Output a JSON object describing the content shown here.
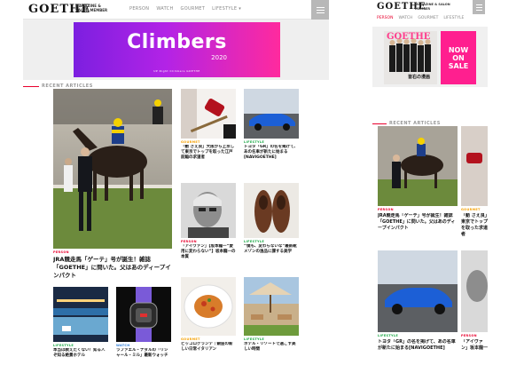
{
  "desktop": {
    "header": {
      "logo": "GOETHE",
      "tagline": "MAGAZINE & SALON MEMBER",
      "nav": [
        "PERSON",
        "WATCH",
        "GOURMET",
        "LIFESTYLE ▾"
      ]
    },
    "banner": {
      "title": "Climbers",
      "year": "2020",
      "credit": "UP Right Climbers GOETHE"
    },
    "section_label": "RECENT ARTICLES",
    "articles": [
      {
        "category": "PERSON",
        "title": "JRA競走馬「ゲーテ」号が誕生！雑誌「GOETHE」に問いた。父はあのディープインパクト"
      },
      {
        "category": "GOURMET",
        "title": "「動 さえ良」大阪から上京して東京でトップを取った江戸前鮨の求道者"
      },
      {
        "category": "LIFESTYLE",
        "title": "トヨタ「GR」の名を掲げて、あの名車が新たに始まる[NAVIGOETHE]"
      },
      {
        "category": "PERSON",
        "title": "「アイヴァン」【坂本龍一“愛用に変わらない”】坂本龍一の本質"
      },
      {
        "category": "LIFESTYLE",
        "title": "“僕も、変わらないな”最新靴メゾンの逸品に課する美学"
      },
      {
        "category": "GOURMET",
        "title": "ピッコログランデ｜銀座の新しい日常イタリアン"
      },
      {
        "category": "LIFESTYLE",
        "title": "ホテル・リゾートで過ごす美しい時間"
      },
      {
        "category": "LIFESTYLE",
        "title": "本当は教えたくない！知る人ぞ知る絶景ホテル"
      },
      {
        "category": "WATCH",
        "title": "ラファエル・ナダルの「リシャール・ミル」最新ウォッチ"
      }
    ]
  },
  "mobile": {
    "header": {
      "logo": "GOETHE",
      "tagline": "MAGAZINE & SALON MEMBER",
      "nav": [
        "PERSON",
        "WATCH",
        "GOURMET",
        "LIFESTYLE"
      ]
    },
    "ad": {
      "magazine_title": "GOETHE",
      "cover_text": "皆右の漫画",
      "sale_text": [
        "NOW",
        "ON",
        "SALE"
      ]
    },
    "section_label": "RECENT ARTICLES",
    "articles": [
      {
        "category": "PERSON",
        "title": "JRA競走馬「ゲーテ」号が誕生！雑誌「GOETHE」に問いた。父はあのディープインパクト"
      },
      {
        "category": "GOURMET",
        "title": "「動 さえ良」東京でトップを取った求道者"
      },
      {
        "category": "LIFESTYLE",
        "title": "トヨタ「GR」の名を掲げて、あの名車が新たに始まる[NAVIGOETHE]"
      },
      {
        "category": "PERSON",
        "title": "「アイヴァン」坂本龍一"
      }
    ]
  },
  "colors": {
    "accent_red": "#e8002d",
    "banner_start": "#7c1fe0",
    "banner_end": "#ff2a9e",
    "sale_pink": "#ff1f8f",
    "cat_person": "#e8002d",
    "cat_gourmet": "#f5a000",
    "cat_lifestyle": "#19a844",
    "cat_watch": "#2a7ad6"
  }
}
